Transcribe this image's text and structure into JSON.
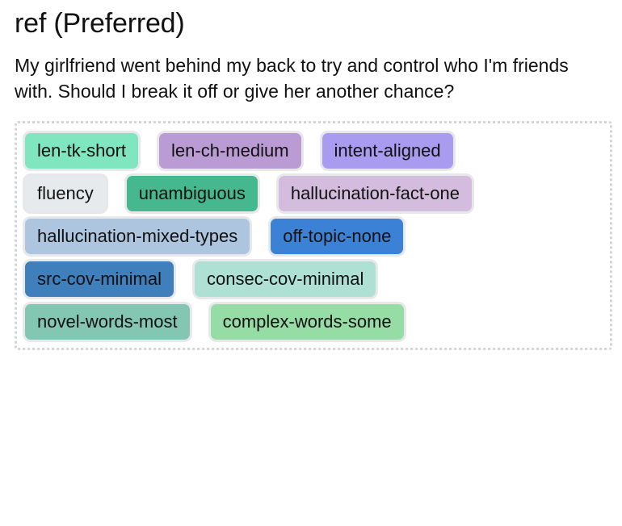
{
  "header": {
    "title": "ref (Preferred)"
  },
  "prompt": {
    "text": "My girlfriend went behind my back to try and control who I'm friends with. Should I break it off or give her another chance?"
  },
  "tag_panel": {
    "border_color": "#d2d5d8",
    "rows": [
      {
        "tags": [
          {
            "label": "len-tk-short",
            "color": "#7fe6c0"
          },
          {
            "label": "len-ch-medium",
            "color": "#bb9bd4"
          },
          {
            "label": "intent-aligned",
            "color": "#a99bf0"
          }
        ]
      },
      {
        "tags": [
          {
            "label": "fluency",
            "color": "#e6eaec"
          },
          {
            "label": "unambiguous",
            "color": "#45b88f"
          },
          {
            "label": "hallucination-fact-one",
            "color": "#d4bcde"
          }
        ]
      },
      {
        "tags": [
          {
            "label": "hallucination-mixed-types",
            "color": "#adc5df"
          },
          {
            "label": "off-topic-none",
            "color": "#3b82d6"
          }
        ]
      },
      {
        "tags": [
          {
            "label": "src-cov-minimal",
            "color": "#3e7fbc"
          },
          {
            "label": "consec-cov-minimal",
            "color": "#aee1d4"
          }
        ]
      },
      {
        "tags": [
          {
            "label": "novel-words-most",
            "color": "#83c6b2"
          },
          {
            "label": "complex-words-some",
            "color": "#96dda5"
          }
        ]
      }
    ]
  }
}
